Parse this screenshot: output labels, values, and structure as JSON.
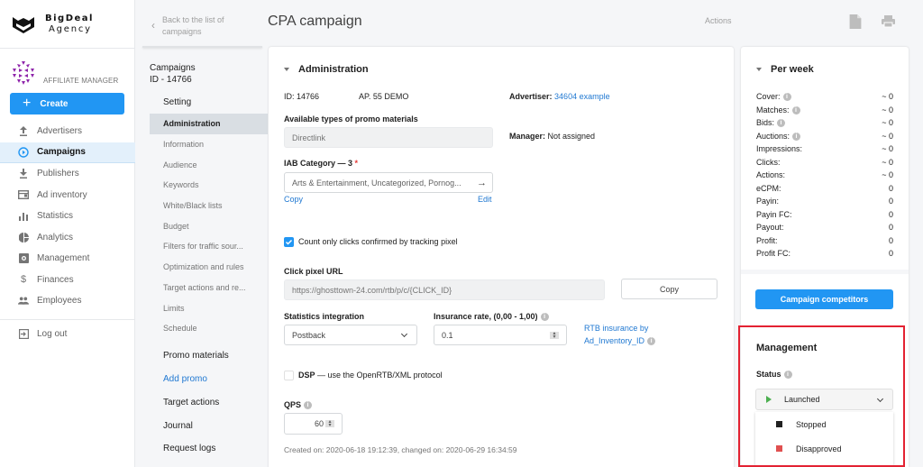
{
  "brand": {
    "line1": "BigDeal",
    "line2": "Agency"
  },
  "user": {
    "role": "AFFILIATE MANAGER"
  },
  "create_label": "Create",
  "sidebar": {
    "items": [
      {
        "label": "Advertisers",
        "icon": "upload-icon"
      },
      {
        "label": "Campaigns",
        "icon": "play-circle-icon",
        "active": true
      },
      {
        "label": "Publishers",
        "icon": "download-icon"
      },
      {
        "label": "Ad inventory",
        "icon": "inventory-icon"
      },
      {
        "label": "Statistics",
        "icon": "bar-chart-icon"
      },
      {
        "label": "Analytics",
        "icon": "pie-chart-icon"
      },
      {
        "label": "Management",
        "icon": "settings-box-icon"
      },
      {
        "label": "Finances",
        "icon": "dollar-icon"
      },
      {
        "label": "Employees",
        "icon": "people-icon"
      }
    ],
    "logout": "Log out"
  },
  "subnav": {
    "back": "Back to the list of campaigns",
    "campaign_title": "Campaigns",
    "campaign_id": "ID - 14766",
    "setting_label": "Setting",
    "items": [
      "Administration",
      "Information",
      "Audience",
      "Keywords",
      "White/Black lists",
      "Budget",
      "Filters for traffic sour...",
      "Optimization and rules",
      "Target actions and re...",
      "Limits",
      "Schedule"
    ],
    "promo_materials": "Promo materials",
    "add_promo": "Add promo",
    "target_actions": "Target actions",
    "journal": "Journal",
    "request_logs": "Request logs"
  },
  "header": {
    "title": "CPA campaign",
    "actions": "Actions"
  },
  "admin": {
    "section_title": "Administration",
    "id": "ID: 14766",
    "ap": "AP. 55 DEMO",
    "advertiser_label": "Advertiser:",
    "advertiser_value": "34604 example",
    "promo_types_label": "Available types of promo materials",
    "promo_types_value": "Directlink",
    "manager_label": "Manager:",
    "manager_value": "Not assigned",
    "iab_label": "IAB Category — 3",
    "iab_required": "*",
    "iab_value": "Arts & Entertainment, Uncategorized, Pornog...",
    "copy_link": "Copy",
    "edit_link": "Edit",
    "count_clicks_label": "Count only clicks confirmed by tracking pixel",
    "count_clicks_checked": true,
    "click_pixel_label": "Click pixel URL",
    "click_pixel_value": "https://ghosttown-24.com/rtb/p/c/{CLICK_ID}",
    "copy_button": "Copy",
    "stats_integration_label": "Statistics integration",
    "stats_integration_value": "Postback",
    "insurance_label": "Insurance rate, (0,00 - 1,00)",
    "insurance_value": "0.1",
    "rtb_insurance_line1": "RTB insurance by",
    "rtb_insurance_line2": "Ad_Inventory_ID",
    "dsp_bold": "DSP",
    "dsp_rest": " — use the OpenRTB/XML protocol",
    "dsp_checked": false,
    "qps_label": "QPS",
    "qps_value": "60",
    "created_text": "Created on: 2020-06-18 19:12:39, changed on: 2020-06-29 16:34:59"
  },
  "per_week": {
    "title": "Per week",
    "rows": [
      {
        "label": "Cover:",
        "value": "~ 0",
        "info": true
      },
      {
        "label": "Matches:",
        "value": "~ 0",
        "info": true
      },
      {
        "label": "Bids:",
        "value": "~ 0",
        "info": true
      },
      {
        "label": "Auctions:",
        "value": "~ 0",
        "info": true
      },
      {
        "label": "Impressions:",
        "value": "~ 0",
        "info": false
      },
      {
        "label": "Clicks:",
        "value": "~ 0",
        "info": false
      },
      {
        "label": "Actions:",
        "value": "~ 0",
        "info": false
      },
      {
        "label": "eCPM:",
        "value": "0",
        "info": false
      },
      {
        "label": "Payin:",
        "value": "0",
        "info": false
      },
      {
        "label": "Payin FC:",
        "value": "0",
        "info": false
      },
      {
        "label": "Payout:",
        "value": "0",
        "info": false
      },
      {
        "label": "Profit:",
        "value": "0",
        "info": false
      },
      {
        "label": "Profit FC:",
        "value": "0",
        "info": false
      }
    ],
    "competitors_button": "Campaign competitors"
  },
  "management": {
    "title": "Management",
    "status_label": "Status",
    "status_value": "Launched",
    "status_color": "#4caf50",
    "options": [
      {
        "label": "Stopped",
        "color": "#212121"
      },
      {
        "label": "Disapproved",
        "color": "#e05050"
      }
    ]
  },
  "colors": {
    "accent": "#2196f3",
    "link": "#2179d2",
    "highlight": "#e32232"
  }
}
